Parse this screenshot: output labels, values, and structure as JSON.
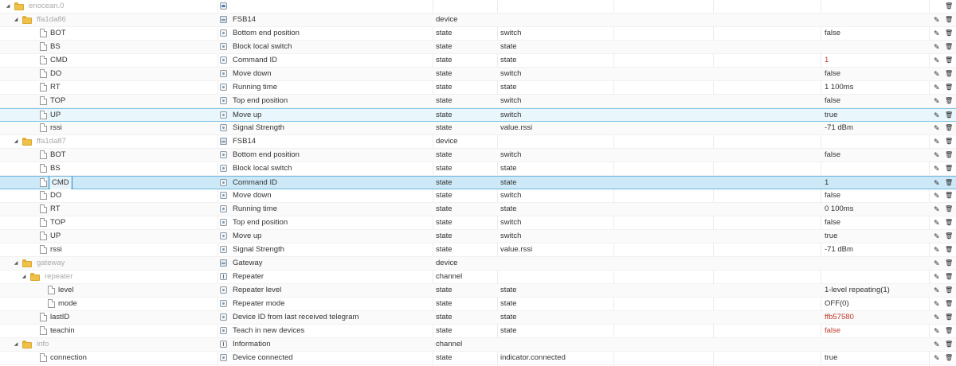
{
  "colors": {
    "accent": "#3a8fc2",
    "error_value": "#c0392b",
    "folder": "#f0c14a"
  },
  "icons": {
    "edit": "pencil-icon",
    "delete": "trash-icon",
    "folder": "folder-icon",
    "state": "file-icon"
  },
  "rows": [
    {
      "id": "enocean.0",
      "kind": "root",
      "level": 0,
      "name": "",
      "type": "",
      "role": "",
      "value": "",
      "ni": "root"
    },
    {
      "id": "ffa1da86",
      "kind": "folder",
      "level": 1,
      "name": "FSB14",
      "type": "device",
      "role": "",
      "value": "",
      "ni": "device"
    },
    {
      "id": "BOT",
      "kind": "state",
      "level": 2,
      "name": "Bottom end position",
      "type": "state",
      "role": "switch",
      "value": "false",
      "ni": "state"
    },
    {
      "id": "BS",
      "kind": "state",
      "level": 2,
      "name": "Block local switch",
      "type": "state",
      "role": "state",
      "value": "",
      "ni": "state"
    },
    {
      "id": "CMD",
      "kind": "state",
      "level": 2,
      "name": "Command ID",
      "type": "state",
      "role": "state",
      "value": "1",
      "valueRed": true,
      "ni": "state"
    },
    {
      "id": "DO",
      "kind": "state",
      "level": 2,
      "name": "Move down",
      "type": "state",
      "role": "switch",
      "value": "false",
      "ni": "state"
    },
    {
      "id": "RT",
      "kind": "state",
      "level": 2,
      "name": "Running time",
      "type": "state",
      "role": "state",
      "value": "1 100ms",
      "ni": "state"
    },
    {
      "id": "TOP",
      "kind": "state",
      "level": 2,
      "name": "Top end position",
      "type": "state",
      "role": "switch",
      "value": "false",
      "ni": "state"
    },
    {
      "id": "UP",
      "kind": "state",
      "level": 2,
      "name": "Move up",
      "type": "state",
      "role": "switch",
      "value": "true",
      "ni": "state",
      "hover": true
    },
    {
      "id": "rssi",
      "kind": "state",
      "level": 2,
      "name": "Signal Strength",
      "type": "state",
      "role": "value.rssi",
      "value": "-71 dBm",
      "ni": "state"
    },
    {
      "id": "ffa1da87",
      "kind": "folder",
      "level": 1,
      "name": "FSB14",
      "type": "device",
      "role": "",
      "value": "",
      "ni": "device"
    },
    {
      "id": "BOT",
      "kind": "state",
      "level": 2,
      "name": "Bottom end position",
      "type": "state",
      "role": "switch",
      "value": "false",
      "ni": "state"
    },
    {
      "id": "BS",
      "kind": "state",
      "level": 2,
      "name": "Block local switch",
      "type": "state",
      "role": "state",
      "value": "",
      "ni": "state"
    },
    {
      "id": "CMD",
      "kind": "state",
      "level": 2,
      "name": "Command ID",
      "type": "state",
      "role": "state",
      "value": "1",
      "ni": "state",
      "selected": true
    },
    {
      "id": "DO",
      "kind": "state",
      "level": 2,
      "name": "Move down",
      "type": "state",
      "role": "switch",
      "value": "false",
      "ni": "state"
    },
    {
      "id": "RT",
      "kind": "state",
      "level": 2,
      "name": "Running time",
      "type": "state",
      "role": "state",
      "value": "0 100ms",
      "ni": "state"
    },
    {
      "id": "TOP",
      "kind": "state",
      "level": 2,
      "name": "Top end position",
      "type": "state",
      "role": "switch",
      "value": "false",
      "ni": "state"
    },
    {
      "id": "UP",
      "kind": "state",
      "level": 2,
      "name": "Move up",
      "type": "state",
      "role": "switch",
      "value": "true",
      "ni": "state"
    },
    {
      "id": "rssi",
      "kind": "state",
      "level": 2,
      "name": "Signal Strength",
      "type": "state",
      "role": "value.rssi",
      "value": "-71 dBm",
      "ni": "state"
    },
    {
      "id": "gateway",
      "kind": "folder",
      "level": 1,
      "name": "Gateway",
      "type": "device",
      "role": "",
      "value": "",
      "ni": "device"
    },
    {
      "id": "repeater",
      "kind": "folder",
      "level": 2,
      "name": "Repeater",
      "type": "channel",
      "role": "",
      "value": "",
      "ni": "channel"
    },
    {
      "id": "level",
      "kind": "state",
      "level": 3,
      "name": "Repeater level",
      "type": "state",
      "role": "state",
      "value": "1-level repeating(1)",
      "ni": "state"
    },
    {
      "id": "mode",
      "kind": "state",
      "level": 3,
      "name": "Repeater mode",
      "type": "state",
      "role": "state",
      "value": "OFF(0)",
      "ni": "state"
    },
    {
      "id": "lastID",
      "kind": "state",
      "level": 2,
      "name": "Device ID from last received telegram",
      "type": "state",
      "role": "state",
      "value": "ffb57580",
      "valueRed": true,
      "ni": "state"
    },
    {
      "id": "teachin",
      "kind": "state",
      "level": 2,
      "name": "Teach in new devices",
      "type": "state",
      "role": "state",
      "value": "false",
      "valueRed": true,
      "ni": "state"
    },
    {
      "id": "info",
      "kind": "folder",
      "level": 1,
      "name": "Information",
      "type": "channel",
      "role": "",
      "value": "",
      "ni": "channel"
    },
    {
      "id": "connection",
      "kind": "state",
      "level": 2,
      "name": "Device connected",
      "type": "state",
      "role": "indicator.connected",
      "value": "true",
      "ni": "state"
    }
  ]
}
